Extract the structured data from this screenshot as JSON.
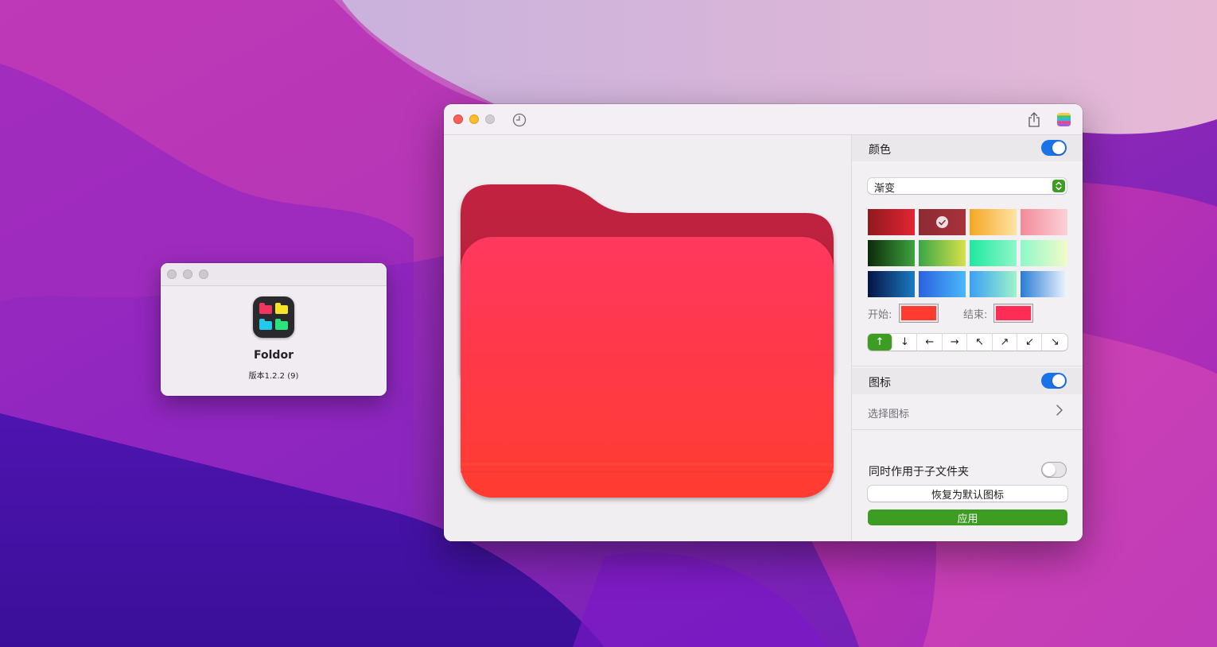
{
  "about_window": {
    "app_name": "Foldor",
    "version": "版本1.2.2 (9)",
    "icon": "foldor-app-icon"
  },
  "main_window": {
    "toolbar": {
      "history_icon": "clock-icon",
      "share_icon": "share-icon",
      "palette_icon": "color-stripes-icon"
    },
    "preview": {
      "folder_icon": "folder-icon",
      "gradient_start": "#ff3b30",
      "gradient_end": "#ff375f"
    },
    "color_section": {
      "title": "颜色",
      "enabled": true,
      "mode_selected": "渐变",
      "swatches": [
        {
          "from": "#8e1a1e",
          "to": "#e42432",
          "selected": false
        },
        {
          "from": "#8d2a33",
          "to": "#a8323c",
          "selected": true
        },
        {
          "from": "#f5a623",
          "to": "#fde4a5",
          "selected": false
        },
        {
          "from": "#f38a98",
          "to": "#fbd1d8",
          "selected": false
        },
        {
          "from": "#0b2a0b",
          "to": "#3fa33f",
          "selected": false
        },
        {
          "from": "#3aa646",
          "to": "#d7e14a",
          "selected": false
        },
        {
          "from": "#1de9a0",
          "to": "#8ff7c9",
          "selected": false
        },
        {
          "from": "#8ff7c9",
          "to": "#f2fbc9",
          "selected": false
        },
        {
          "from": "#061446",
          "to": "#1b7bc2",
          "selected": false
        },
        {
          "from": "#2a62e0",
          "to": "#4ab8f8",
          "selected": false
        },
        {
          "from": "#3aa0f5",
          "to": "#9ef3c8",
          "selected": false
        },
        {
          "from": "#2a7bd5",
          "to": "#f0f7fd",
          "selected": false
        }
      ],
      "start_label": "开始:",
      "start_color": "#ff3b30",
      "end_label": "结束:",
      "end_color": "#ff2d55",
      "directions": [
        "↑",
        "↓",
        "←",
        "→",
        "↖",
        "↗",
        "↙",
        "↘"
      ],
      "direction_selected": 0
    },
    "icon_section": {
      "title": "图标",
      "enabled": true,
      "choose_icon_label": "选择图标"
    },
    "apply_subfolders_label": "同时作用于子文件夹",
    "apply_subfolders_enabled": false,
    "reset_button": "恢复为默认图标",
    "apply_button": "应用",
    "accent_color": "#3c9d22",
    "toggle_color": "#1a73e8"
  }
}
